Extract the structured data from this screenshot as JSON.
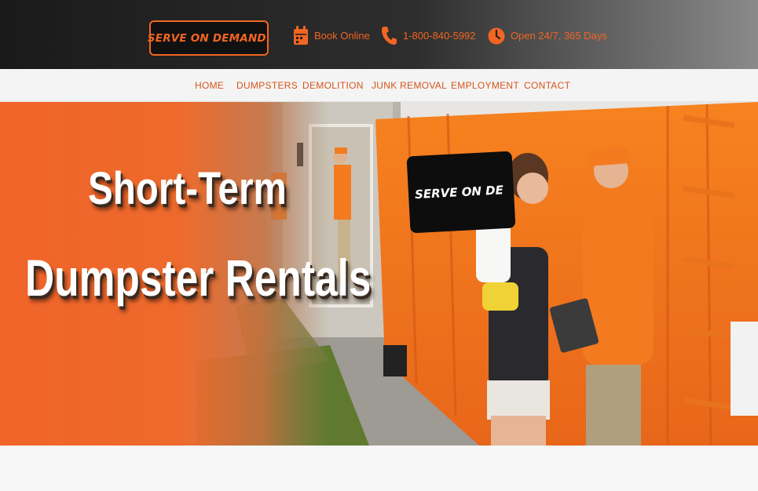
{
  "header": {
    "logo_text": "SERVE ON DEMAND.",
    "book_label": "Book Online",
    "phone_label": "1-800-840-5992",
    "hours_label": "Open 24/7, 365 Days",
    "icons": [
      "calendar-icon",
      "phone-icon",
      "clock-icon"
    ]
  },
  "nav": {
    "items": [
      {
        "label": "HOME"
      },
      {
        "label": "DUMPSTERS"
      },
      {
        "label": "DEMOLITION"
      },
      {
        "label": "JUNK REMOVAL"
      },
      {
        "label": "EMPLOYMENT"
      },
      {
        "label": "CONTACT"
      }
    ]
  },
  "hero": {
    "headline_line1": "Short-Term",
    "headline_line2": "Dumpster Rentals",
    "sign_text": "SERVE ON DE"
  },
  "colors": {
    "accent": "#f26522",
    "nav_text": "#d6541a",
    "topbar_dark": "#1a1a1a",
    "dumpster_orange": "#f47a20"
  }
}
